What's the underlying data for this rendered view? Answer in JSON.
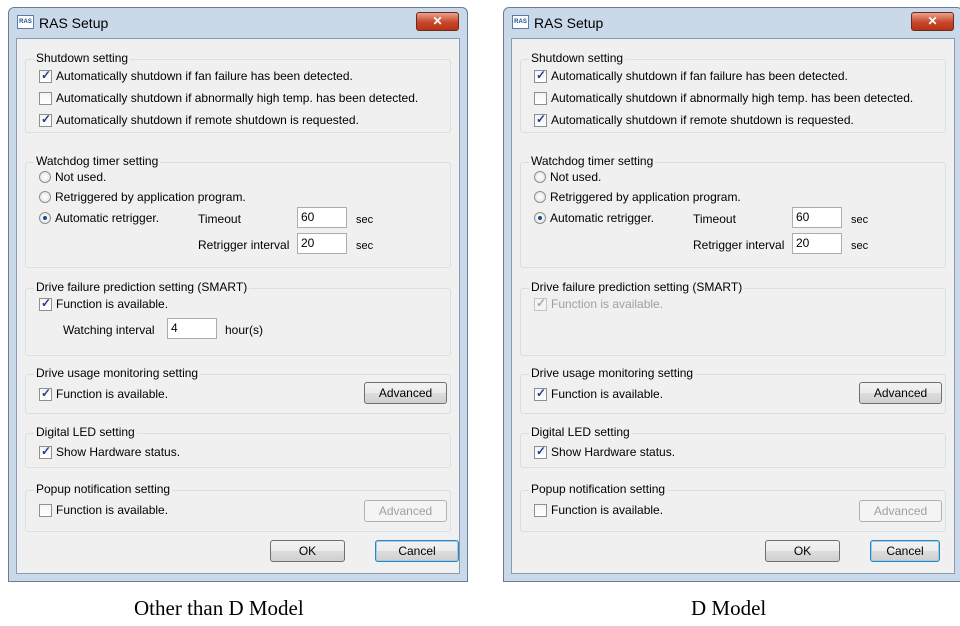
{
  "dialogs": [
    {
      "title": "RAS Setup",
      "app_icon_text": "RAS",
      "shutdown": {
        "label": "Shutdown setting",
        "opt1": "Automatically shutdown if fan failure has been detected.",
        "opt2": "Automatically shutdown if abnormally high temp. has been detected.",
        "opt3": "Automatically shutdown if remote shutdown is requested."
      },
      "watchdog": {
        "label": "Watchdog timer setting",
        "opt1": "Not used.",
        "opt2": "Retriggered by application program.",
        "opt3": "Automatic retrigger.",
        "timeout_label": "Timeout",
        "timeout_value": "60",
        "timeout_unit": "sec",
        "interval_label": "Retrigger interval",
        "interval_value": "20",
        "interval_unit": "sec"
      },
      "smart": {
        "label": "Drive failure prediction setting (SMART)",
        "func": "Function is available.",
        "watch_label": "Watching interval",
        "watch_value": "4",
        "watch_unit": "hour(s)"
      },
      "usage": {
        "label": "Drive usage monitoring setting",
        "func": "Function is available.",
        "advanced": "Advanced"
      },
      "led": {
        "label": "Digital LED setting",
        "func": "Show Hardware status."
      },
      "popup": {
        "label": "Popup notification setting",
        "func": "Function is available.",
        "advanced": "Advanced"
      },
      "ok": "OK",
      "cancel": "Cancel",
      "caption": "Other than D Model"
    },
    {
      "title": "RAS Setup",
      "app_icon_text": "RAS",
      "shutdown": {
        "label": "Shutdown setting",
        "opt1": "Automatically shutdown if fan failure has been detected.",
        "opt2": "Automatically shutdown if abnormally high temp. has been detected.",
        "opt3": "Automatically shutdown if remote shutdown is requested."
      },
      "watchdog": {
        "label": "Watchdog timer setting",
        "opt1": "Not used.",
        "opt2": "Retriggered by application program.",
        "opt3": "Automatic retrigger.",
        "timeout_label": "Timeout",
        "timeout_value": "60",
        "timeout_unit": "sec",
        "interval_label": "Retrigger interval",
        "interval_value": "20",
        "interval_unit": "sec"
      },
      "smart": {
        "label": "Drive failure prediction setting (SMART)",
        "func": "Function is available."
      },
      "usage": {
        "label": "Drive usage monitoring setting",
        "func": "Function is available.",
        "advanced": "Advanced"
      },
      "led": {
        "label": "Digital LED setting",
        "func": "Show Hardware status."
      },
      "popup": {
        "label": "Popup notification setting",
        "func": "Function is available.",
        "advanced": "Advanced"
      },
      "ok": "OK",
      "cancel": "Cancel",
      "caption": "D Model"
    }
  ]
}
